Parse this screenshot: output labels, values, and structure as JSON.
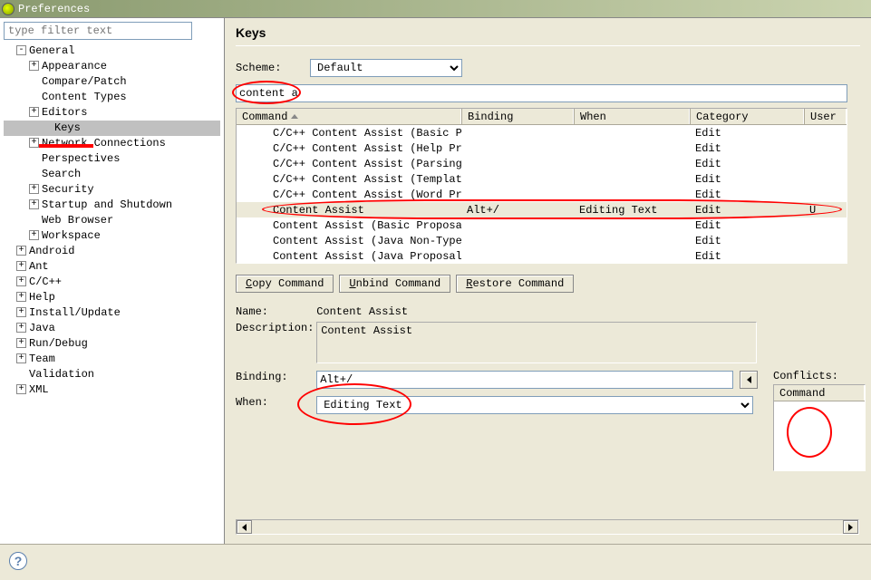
{
  "window": {
    "title": "Preferences"
  },
  "sidebar": {
    "filter_placeholder": "type filter text",
    "nodes": [
      {
        "label": "General",
        "expand": "-",
        "indent": 1,
        "children": [
          {
            "label": "Appearance",
            "expand": "+",
            "indent": 2
          },
          {
            "label": "Compare/Patch",
            "expand": "",
            "indent": 2
          },
          {
            "label": "Content Types",
            "expand": "",
            "indent": 2
          },
          {
            "label": "Editors",
            "expand": "+",
            "indent": 2
          },
          {
            "label": "Keys",
            "expand": "",
            "indent": 3,
            "selected": true
          },
          {
            "label": "Network Connections",
            "expand": "+",
            "indent": 2
          },
          {
            "label": "Perspectives",
            "expand": "",
            "indent": 2
          },
          {
            "label": "Search",
            "expand": "",
            "indent": 2
          },
          {
            "label": "Security",
            "expand": "+",
            "indent": 2
          },
          {
            "label": "Startup and Shutdown",
            "expand": "+",
            "indent": 2
          },
          {
            "label": "Web Browser",
            "expand": "",
            "indent": 2
          },
          {
            "label": "Workspace",
            "expand": "+",
            "indent": 2
          }
        ]
      },
      {
        "label": "Android",
        "expand": "+",
        "indent": 1
      },
      {
        "label": "Ant",
        "expand": "+",
        "indent": 1
      },
      {
        "label": "C/C++",
        "expand": "+",
        "indent": 1
      },
      {
        "label": "Help",
        "expand": "+",
        "indent": 1
      },
      {
        "label": "Install/Update",
        "expand": "+",
        "indent": 1
      },
      {
        "label": "Java",
        "expand": "+",
        "indent": 1
      },
      {
        "label": "Run/Debug",
        "expand": "+",
        "indent": 1
      },
      {
        "label": "Team",
        "expand": "+",
        "indent": 1
      },
      {
        "label": "Validation",
        "expand": "",
        "indent": 1
      },
      {
        "label": "XML",
        "expand": "+",
        "indent": 1
      }
    ]
  },
  "page": {
    "title": "Keys",
    "scheme_label": "Scheme:",
    "scheme_value": "Default",
    "search_value": "content a",
    "columns": {
      "command": "Command",
      "binding": "Binding",
      "when": "When",
      "category": "Category",
      "user": "User"
    },
    "rows": [
      {
        "cmd": "C/C++ Content Assist (Basic Propo",
        "bnd": "",
        "whn": "",
        "cat": "Edit",
        "usr": ""
      },
      {
        "cmd": "C/C++ Content Assist (Help Propos",
        "bnd": "",
        "whn": "",
        "cat": "Edit",
        "usr": ""
      },
      {
        "cmd": "C/C++ Content Assist (Parsing-bas",
        "bnd": "",
        "whn": "",
        "cat": "Edit",
        "usr": ""
      },
      {
        "cmd": "C/C++ Content Assist (Template Pr",
        "bnd": "",
        "whn": "",
        "cat": "Edit",
        "usr": ""
      },
      {
        "cmd": "C/C++ Content Assist (Word Propos",
        "bnd": "",
        "whn": "",
        "cat": "Edit",
        "usr": ""
      },
      {
        "cmd": "Content Assist",
        "bnd": "Alt+/",
        "whn": "Editing Text",
        "cat": "Edit",
        "usr": "U",
        "selected": true
      },
      {
        "cmd": "Content Assist (Basic Proposals)",
        "bnd": "",
        "whn": "",
        "cat": "Edit",
        "usr": ""
      },
      {
        "cmd": "Content Assist (Java Non-Type Pro",
        "bnd": "",
        "whn": "",
        "cat": "Edit",
        "usr": ""
      },
      {
        "cmd": "Content Assist (Java Proposals)",
        "bnd": "",
        "whn": "",
        "cat": "Edit",
        "usr": ""
      }
    ],
    "buttons": {
      "copy": "Copy Command",
      "unbind": "Unbind Command",
      "restore": "Restore Command"
    },
    "details": {
      "name_label": "Name:",
      "name_value": "Content Assist",
      "desc_label": "Description:",
      "desc_value": "Content Assist",
      "binding_label": "Binding:",
      "binding_value": "Alt+/",
      "when_label": "When:",
      "when_value": "Editing Text"
    },
    "conflicts": {
      "label": "Conflicts:",
      "col": "Command"
    }
  },
  "help_glyph": "?"
}
